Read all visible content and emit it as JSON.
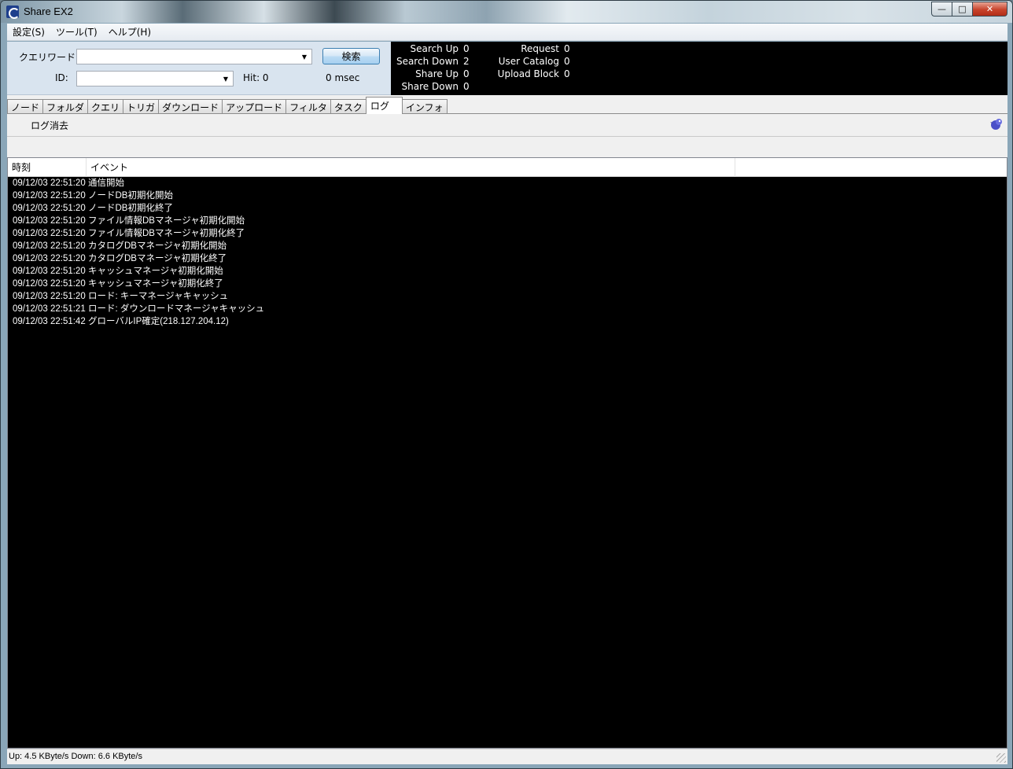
{
  "window": {
    "title": "Share EX2"
  },
  "menu": [
    "設定(S)",
    "ツール(T)",
    "ヘルプ(H)"
  ],
  "query": {
    "keyword_label": "クエリワード:",
    "keyword_value": "",
    "id_label": "ID:",
    "id_value": "",
    "search_button": "検索",
    "hit_label": "Hit: 0",
    "msec_label": "0 msec"
  },
  "stats": {
    "search_up": {
      "label": "Search Up",
      "value": "0"
    },
    "search_down": {
      "label": "Search Down",
      "value": "2"
    },
    "share_up": {
      "label": "Share Up",
      "value": "0"
    },
    "share_down": {
      "label": "Share Down",
      "value": "0"
    },
    "request": {
      "label": "Request",
      "value": "0"
    },
    "user_catalog": {
      "label": "User Catalog",
      "value": "0"
    },
    "upload_block": {
      "label": "Upload Block",
      "value": "0"
    }
  },
  "tabs": [
    "ノード",
    "フォルダ",
    "クエリ",
    "トリガ",
    "ダウンロード",
    "アップロード",
    "フィルタ",
    "タスク",
    "ログ",
    "インフォ"
  ],
  "active_tab": "ログ",
  "toolbar": {
    "log_clear": "ログ消去"
  },
  "log": {
    "columns": [
      "時刻",
      "イベント",
      ""
    ],
    "rows": [
      {
        "time": "09/12/03 22:51:20",
        "event": "通信開始"
      },
      {
        "time": "09/12/03 22:51:20",
        "event": "ノードDB初期化開始"
      },
      {
        "time": "09/12/03 22:51:20",
        "event": "ノードDB初期化終了"
      },
      {
        "time": "09/12/03 22:51:20",
        "event": "ファイル情報DBマネージャ初期化開始"
      },
      {
        "time": "09/12/03 22:51:20",
        "event": "ファイル情報DBマネージャ初期化終了"
      },
      {
        "time": "09/12/03 22:51:20",
        "event": "カタログDBマネージャ初期化開始"
      },
      {
        "time": "09/12/03 22:51:20",
        "event": "カタログDBマネージャ初期化終了"
      },
      {
        "time": "09/12/03 22:51:20",
        "event": "キャッシュマネージャ初期化開始"
      },
      {
        "time": "09/12/03 22:51:20",
        "event": "キャッシュマネージャ初期化終了"
      },
      {
        "time": "09/12/03 22:51:20",
        "event": "ロード: キーマネージャキャッシュ"
      },
      {
        "time": "09/12/03 22:51:21",
        "event": "ロード: ダウンロードマネージャキャッシュ"
      },
      {
        "time": "09/12/03 22:51:42",
        "event": "グローバルIP確定(218.127.204.12)"
      }
    ]
  },
  "status": {
    "text": "Up: 4.5 KByte/s Down: 6.6 KByte/s"
  }
}
